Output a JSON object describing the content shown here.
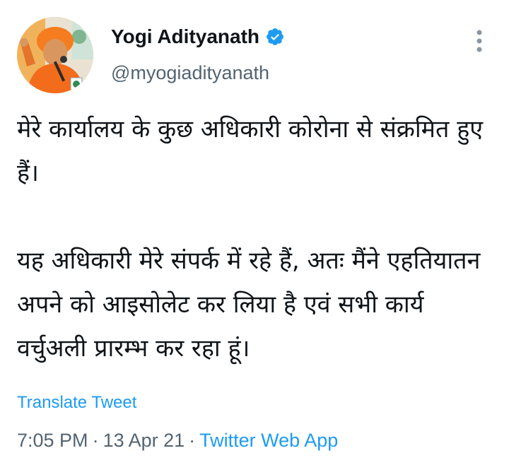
{
  "author": {
    "display_name": "Yogi Adityanath",
    "handle": "@myogiadityanath",
    "verified": true
  },
  "icons": {
    "verified": "verified-badge-icon",
    "more": "more-vertical-icon",
    "avatar": "profile-avatar"
  },
  "tweet": {
    "paragraphs": [
      "मेरे कार्यालय के कुछ अधिकारी कोरोना से संक्रमित हुए हैं।",
      "यह अधिकारी मेरे संपर्क में रहे हैं, अतः मैंने एहतियातन अपने को आइसोलेट कर लिया है एवं सभी कार्य वर्चुअली प्रारम्भ कर रहा हूं।"
    ],
    "translate_label": "Translate Tweet",
    "time": "7:05 PM",
    "date": "13 Apr 21",
    "source": "Twitter Web App",
    "separator": "·"
  },
  "colors": {
    "text": "#0f1419",
    "secondary": "#536471",
    "accent": "#1d9bf0"
  }
}
